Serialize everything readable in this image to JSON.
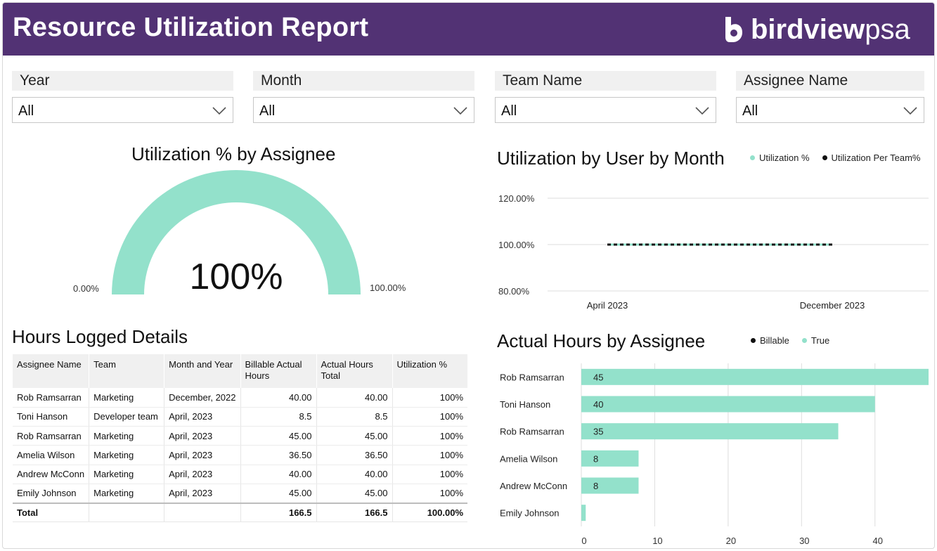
{
  "header": {
    "title": "Resource Utilization Report",
    "logo_bold": "birdview",
    "logo_light": "psa"
  },
  "filters": [
    {
      "label": "Year",
      "value": "All"
    },
    {
      "label": "Month",
      "value": "All"
    },
    {
      "label": "Team Name",
      "value": "All"
    },
    {
      "label": "Assignee Name",
      "value": "All"
    }
  ],
  "gauge": {
    "title": "Utilization % by Assignee",
    "value_text": "100%",
    "min_label": "0.00%",
    "max_label": "100.00%",
    "color": "#93e1cb",
    "fraction": 1.0
  },
  "line_chart": {
    "title": "Utilization by User by Month",
    "legend": [
      {
        "name": "Utilization %",
        "color": "#93e1cb"
      },
      {
        "name": "Utilization Per Team%",
        "color": "#111111"
      }
    ]
  },
  "table": {
    "title": "Hours Logged Details",
    "columns": [
      "Assignee Name",
      "Team",
      "Month and Year",
      "Billable Actual Hours",
      "Actual Hours Total",
      "Utilization %"
    ],
    "rows": [
      [
        "Rob Ramsarran",
        "Marketing",
        "December, 2022",
        "40.00",
        "40.00",
        "100%"
      ],
      [
        "Toni Hanson",
        "Developer team",
        "April, 2023",
        "8.5",
        "8.5",
        "100%"
      ],
      [
        "Rob Ramsarran",
        "Marketing",
        "April, 2023",
        "45.00",
        "45.00",
        "100%"
      ],
      [
        "Amelia Wilson",
        "Marketing",
        "April, 2023",
        "36.50",
        "36.50",
        "100%"
      ],
      [
        "Andrew McConn",
        "Marketing",
        "April, 2023",
        "40.00",
        "40.00",
        "100%"
      ],
      [
        "Emily Johnson",
        "Marketing",
        "April, 2023",
        "45.00",
        "45.00",
        "100%"
      ]
    ],
    "total": [
      "Total",
      "",
      "",
      "166.5",
      "166.5",
      "100.00%"
    ]
  },
  "bar_chart": {
    "title": "Actual Hours by Assignee",
    "legend": [
      {
        "name": "Billable",
        "color": "#111111"
      },
      {
        "name": "True",
        "color": "#93e1cb"
      }
    ]
  },
  "chart_data": [
    {
      "type": "line",
      "title": "Utilization by User by Month",
      "x": [
        "April 2023",
        "December 2023"
      ],
      "x_range": [
        "April 2023",
        "December 2023"
      ],
      "ylim": [
        80,
        120
      ],
      "yticks": [
        "80.00%",
        "100.00%",
        "120.00%"
      ],
      "ytick_values": [
        80,
        100,
        120
      ],
      "series": [
        {
          "name": "Utilization %",
          "values": [
            100,
            100
          ],
          "color": "#93e1cb"
        },
        {
          "name": "Utilization Per Team%",
          "values": [
            100,
            100
          ],
          "color": "#111111",
          "dashed": true
        }
      ],
      "grid": true,
      "legend_position": "top-right"
    },
    {
      "type": "bar",
      "orientation": "horizontal",
      "title": "Actual Hours by Assignee",
      "categories": [
        "Rob Ramsarran",
        "Toni Hanson",
        "Rob Ramsarran",
        "Amelia Wilson",
        "Andrew McConn",
        "Emily Johnson"
      ],
      "values": [
        47.3,
        40,
        35,
        7.8,
        7.8,
        0.6
      ],
      "data_labels": [
        "45",
        "40",
        "35",
        "8",
        "8",
        ""
      ],
      "xlim": [
        0,
        47.3
      ],
      "xticks": [
        0,
        10,
        20,
        30,
        40
      ],
      "series_name": "True",
      "color": "#93e1cb",
      "grid": true,
      "legend_position": "top-right"
    }
  ]
}
